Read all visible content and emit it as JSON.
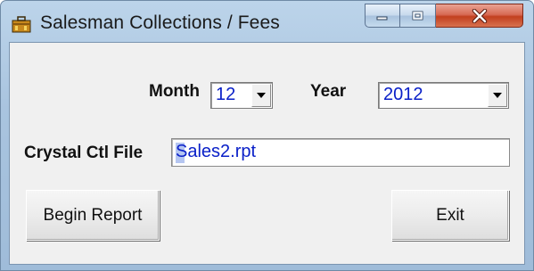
{
  "window": {
    "title": "Salesman Collections / Fees",
    "app_icon": "briefcase-icon",
    "caption_buttons": [
      "minimize-icon",
      "maximize-icon",
      "close-icon"
    ]
  },
  "form": {
    "month_label": "Month",
    "month_value": "12",
    "year_label": "Year",
    "year_value": "2012",
    "crystal_label": "Crystal Ctl File",
    "crystal_value": "Sales2.rpt"
  },
  "buttons": {
    "begin_report": "Begin Report",
    "exit": "Exit"
  },
  "colors": {
    "value_text": "#0a20c8",
    "title_bar": "#a9c4df",
    "close_button": "#c2401f"
  }
}
